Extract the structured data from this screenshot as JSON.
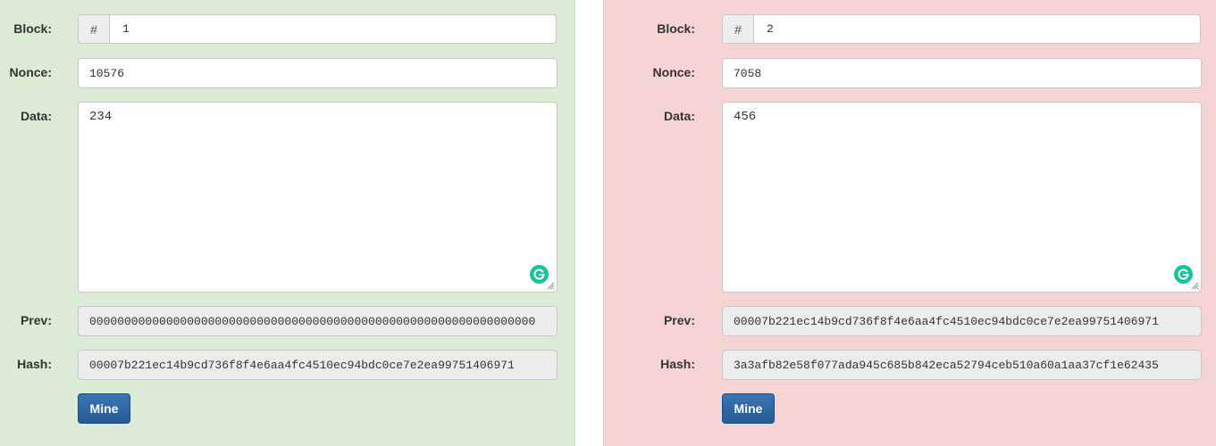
{
  "labels": {
    "block": "Block:",
    "nonce": "Nonce:",
    "data": "Data:",
    "prev": "Prev:",
    "hash": "Hash:",
    "mine": "Mine",
    "hash_symbol": "#"
  },
  "blocks": [
    {
      "status": "valid",
      "background": "#dbebd5",
      "number": "1",
      "nonce": "10576",
      "data": "234",
      "prev": "0000000000000000000000000000000000000000000000000000000000000000",
      "hash": "00007b221ec14b9cd736f8f4e6aa4fc4510ec94bdc0ce7e2ea99751406971"
    },
    {
      "status": "invalid",
      "background": "#f6d4d4",
      "number": "2",
      "nonce": "7058",
      "data": "456",
      "prev": "00007b221ec14b9cd736f8f4e6aa4fc4510ec94bdc0ce7e2ea99751406971",
      "hash": "3a3afb82e58f077ada945c685b842eca52794ceb510a60a1aa37cf1e62435"
    }
  ]
}
